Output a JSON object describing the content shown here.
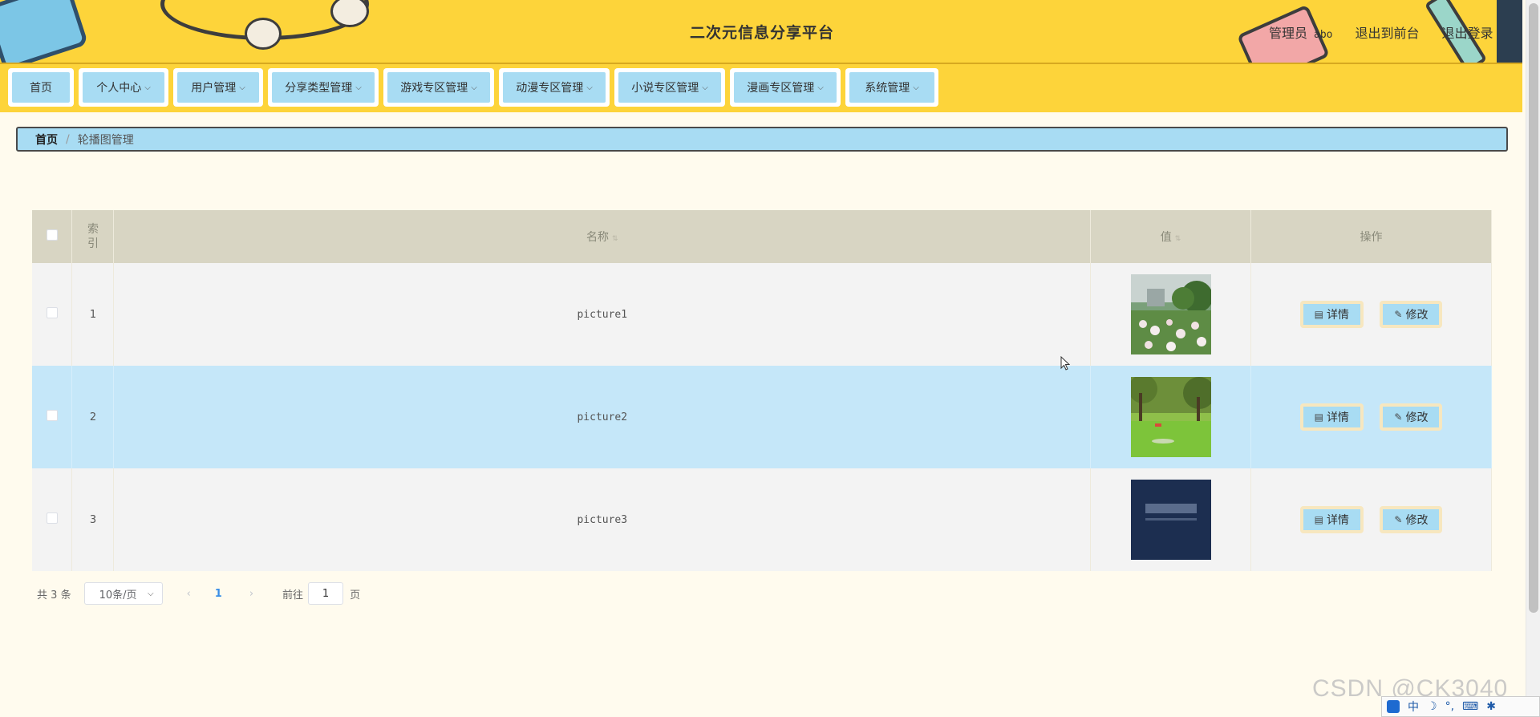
{
  "header": {
    "title": "二次元信息分享平台",
    "role": "管理员",
    "username": "abo",
    "front_link": "退出到前台",
    "logout_link": "退出登录"
  },
  "nav": {
    "items": [
      {
        "label": "首页",
        "has_dropdown": false
      },
      {
        "label": "个人中心",
        "has_dropdown": true
      },
      {
        "label": "用户管理",
        "has_dropdown": true
      },
      {
        "label": "分享类型管理",
        "has_dropdown": true
      },
      {
        "label": "游戏专区管理",
        "has_dropdown": true
      },
      {
        "label": "动漫专区管理",
        "has_dropdown": true
      },
      {
        "label": "小说专区管理",
        "has_dropdown": true
      },
      {
        "label": "漫画专区管理",
        "has_dropdown": true
      },
      {
        "label": "系统管理",
        "has_dropdown": true
      }
    ]
  },
  "breadcrumb": {
    "home": "首页",
    "current": "轮播图管理"
  },
  "table": {
    "headers": {
      "index": "索引",
      "name": "名称",
      "value": "值",
      "actions": "操作"
    },
    "rows": [
      {
        "index": "1",
        "name": "picture1",
        "image": "garden-photo"
      },
      {
        "index": "2",
        "name": "picture2",
        "image": "park-lawn-photo"
      },
      {
        "index": "3",
        "name": "picture3",
        "image": "blue-book-cover-photo"
      }
    ],
    "detail_label": "详情",
    "edit_label": "修改"
  },
  "pagination": {
    "total_prefix": "共",
    "total": "3",
    "total_suffix": "条",
    "page_size": "10条/页",
    "current_page": "1",
    "goto_label": "前往",
    "goto_value": "1",
    "page_suffix": "页"
  },
  "watermark": "CSDN @CK3040",
  "ime": {
    "lang": "中"
  },
  "colors": {
    "header_bg": "#fdd43a",
    "nav_button": "#a8dcf3",
    "page_bg": "#fffbee",
    "table_header": "#d8d5c3",
    "row_highlight": "#c5e7f9"
  }
}
